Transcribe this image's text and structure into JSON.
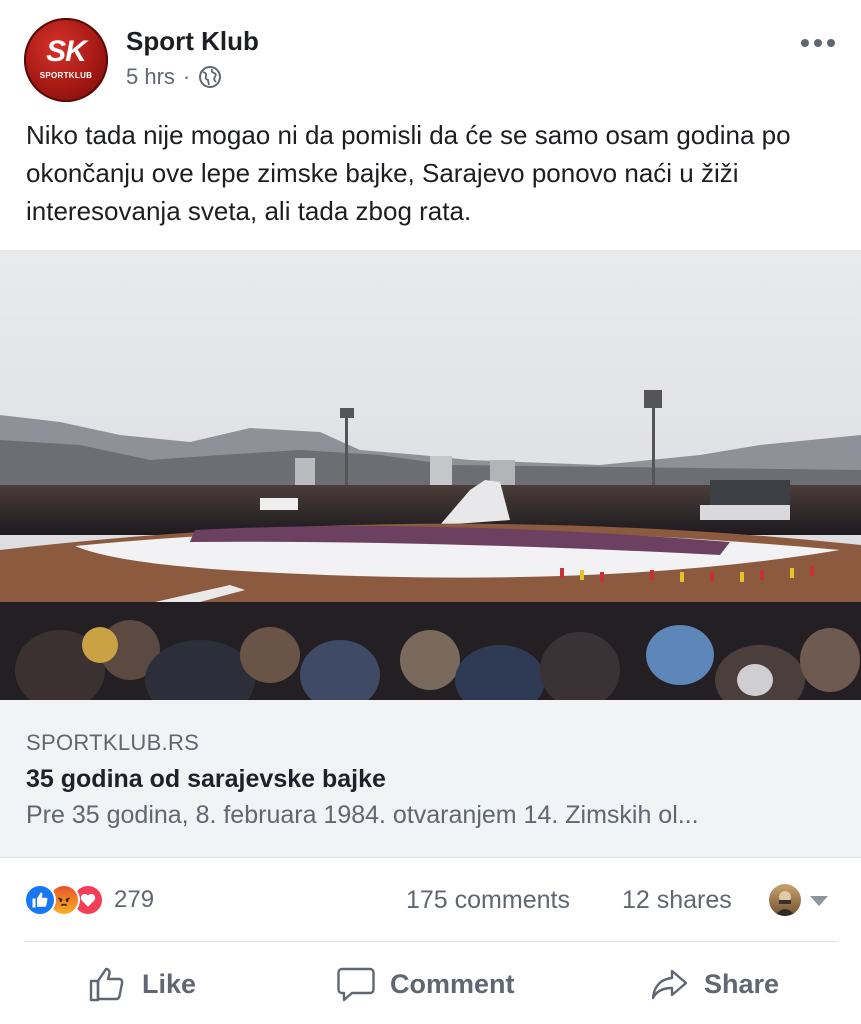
{
  "post": {
    "page_name": "Sport Klub",
    "avatar_text": "SK",
    "avatar_subtext": "SPORTKLUB",
    "timestamp": "5 hrs",
    "separator": "·",
    "privacy_icon": "globe-icon",
    "text": "Niko tada nije mogao ni da pomisli da će se samo osam godina po okončanju ove lepe zimske bajke, Sarajevo ponovo naći u žiži interesovanja sveta, ali tada zbog rata."
  },
  "link": {
    "domain": "SPORTKLUB.RS",
    "title": "35 godina od sarajevske bajke",
    "description": "Pre 35 godina, 8. februara 1984. otvaranjem 14. Zimskih ol..."
  },
  "stats": {
    "reactions_count": "279",
    "reaction_icons": [
      "like-reaction-icon",
      "angry-reaction-icon",
      "love-reaction-icon"
    ],
    "comments": "175 comments",
    "shares": "12 shares"
  },
  "actions": {
    "like": "Like",
    "comment": "Comment",
    "share": "Share"
  },
  "colors": {
    "brand_red": "#b91c15",
    "text_primary": "#1c1e21",
    "text_secondary": "#606770",
    "like_blue": "#1877f2",
    "love_red": "#f33e58"
  }
}
